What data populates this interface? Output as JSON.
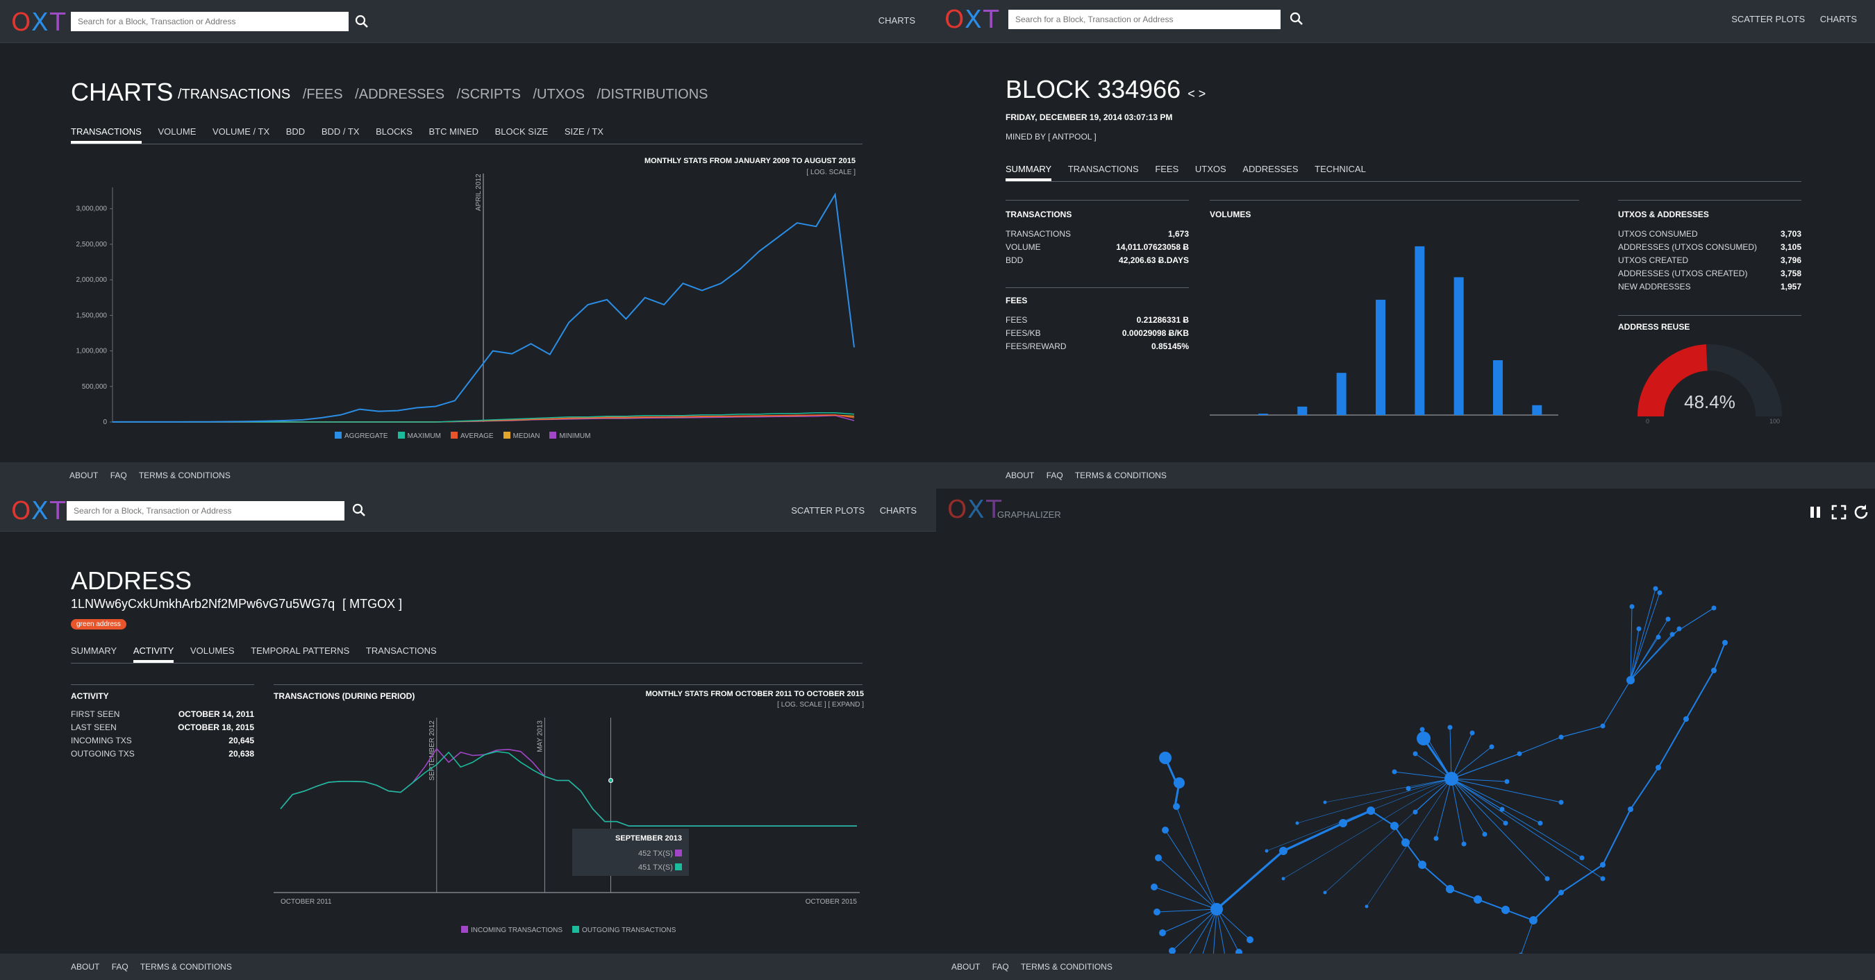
{
  "brand": {
    "logo": "OXT"
  },
  "p1": {
    "search_placeholder": "Search for a Block, Transaction or Address",
    "nav": [
      "CHARTS"
    ],
    "title": "CHARTS",
    "sections": [
      "/TRANSACTIONS",
      "/FEES",
      "/ADDRESSES",
      "/SCRIPTS",
      "/UTXOS",
      "/DISTRIBUTIONS"
    ],
    "tabs": [
      "TRANSACTIONS",
      "VOLUME",
      "VOLUME / TX",
      "BDD",
      "BDD / TX",
      "BLOCKS",
      "BTC MINED",
      "BLOCK SIZE",
      "SIZE / TX"
    ],
    "chart_caption": "MONTHLY STATS FROM JANUARY 2009 TO AUGUST 2015",
    "chart_subcaption": "[ LOG. SCALE ]",
    "marker_label": "APRIL 2012",
    "footer": [
      "ABOUT",
      "FAQ",
      "TERMS & CONDITIONS"
    ]
  },
  "p2": {
    "search_placeholder": "Search for a Block, Transaction or Address",
    "nav": [
      "SCATTER PLOTS",
      "CHARTS"
    ],
    "title": "BLOCK 334966",
    "title_arrows": "< >",
    "date": "FRIDAY, DECEMBER 19, 2014 03:07:13 PM",
    "mined_by": "MINED BY [ ANTPOOL ]",
    "tabs": [
      "SUMMARY",
      "TRANSACTIONS",
      "FEES",
      "UTXOS",
      "ADDRESSES",
      "TECHNICAL"
    ],
    "tx_heading": "TRANSACTIONS",
    "tx_rows": [
      {
        "label": "TRANSACTIONS",
        "value": "1,673"
      },
      {
        "label": "VOLUME",
        "value": "14,011.07623058 Ƀ"
      },
      {
        "label": "BDD",
        "value": "42,206.63 Ƀ.DAYS"
      }
    ],
    "fees_heading": "FEES",
    "fees_rows": [
      {
        "label": "FEES",
        "value": "0.21286331 Ƀ"
      },
      {
        "label": "FEES/KB",
        "value": "0.00029098 Ƀ/KB"
      },
      {
        "label": "FEES/REWARD",
        "value": "0.85145%"
      }
    ],
    "volumes_heading": "VOLUMES",
    "utxo_heading": "UTXOS & ADDRESSES",
    "utxo_rows": [
      {
        "label": "UTXOS CONSUMED",
        "value": "3,703"
      },
      {
        "label": "ADDRESSES (UTXOS CONSUMED)",
        "value": "3,105"
      },
      {
        "label": "UTXOS CREATED",
        "value": "3,796"
      },
      {
        "label": "ADDRESSES (UTXOS CREATED)",
        "value": "3,758"
      },
      {
        "label": "NEW ADDRESSES",
        "value": "1,957"
      }
    ],
    "reuse_heading": "ADDRESS REUSE",
    "reuse_value": "48.4%",
    "reuse_fraction": 0.484,
    "gauge_min": "0",
    "gauge_max": "100",
    "footer": [
      "ABOUT",
      "FAQ",
      "TERMS & CONDITIONS"
    ]
  },
  "p3": {
    "search_placeholder": "Search for a Block, Transaction or Address",
    "nav": [
      "SCATTER PLOTS",
      "CHARTS"
    ],
    "title": "ADDRESS",
    "address": "1LNWw6yCxkUmkhArb2Nf2MPw6vG7u5WG7q",
    "address_tag": "[ MTGOX ]",
    "badge": "green address",
    "tabs": [
      "SUMMARY",
      "ACTIVITY",
      "VOLUMES",
      "TEMPORAL PATTERNS",
      "TRANSACTIONS"
    ],
    "activity_heading": "ACTIVITY",
    "activity_rows": [
      {
        "label": "FIRST SEEN",
        "value": "OCTOBER 14, 2011"
      },
      {
        "label": "LAST SEEN",
        "value": "OCTOBER 18, 2015"
      },
      {
        "label": "INCOMING TXS",
        "value": "20,645"
      },
      {
        "label": "OUTGOING TXS",
        "value": "20,638"
      }
    ],
    "chart_heading": "TRANSACTIONS (DURING PERIOD)",
    "chart_caption": "MONTHLY STATS FROM OCTOBER 2011 TO OCTOBER 2015",
    "chart_subcaption": "[ LOG. SCALE ] [ EXPAND ]",
    "markers": [
      "SEPTEMBER 2012",
      "MAY 2013"
    ],
    "x_start": "OCTOBER 2011",
    "x_end": "OCTOBER 2015",
    "tooltip": {
      "title": "SEPTEMBER 2013",
      "in": "452 TX(S)",
      "out": "451 TX(S)"
    },
    "footer": [
      "ABOUT",
      "FAQ",
      "TERMS & CONDITIONS"
    ]
  },
  "p4": {
    "app_name": "GRAPHALIZER",
    "footer": [
      "ABOUT",
      "FAQ",
      "TERMS & CONDITIONS"
    ]
  },
  "colors": {
    "aggregate": "#2b8ee6",
    "maximum": "#1abc9c",
    "average": "#e8552a",
    "median": "#e0a52a",
    "minimum": "#a246c8",
    "incoming": "#a246c8",
    "outgoing": "#1abc9c"
  },
  "chart_data": [
    {
      "type": "line",
      "title": "MONTHLY STATS FROM JANUARY 2009 TO AUGUST 2015",
      "xlabel": "",
      "ylabel": "",
      "y_ticks": [
        "3,000,000",
        "2,500,000",
        "2,000,000",
        "1,500,000",
        "1,000,000",
        "500,000",
        "0"
      ],
      "ylim": [
        0,
        3300000
      ],
      "x": [
        1,
        3,
        5,
        7,
        9,
        11,
        13,
        15,
        17,
        19,
        21,
        23,
        25,
        27,
        29,
        31,
        33,
        35,
        37,
        39,
        41,
        43,
        45,
        47,
        49,
        51,
        53,
        55,
        57,
        59,
        61,
        63,
        65,
        67,
        69,
        71,
        73,
        75,
        77,
        79
      ],
      "series": [
        {
          "name": "AGGREGATE",
          "values": [
            500,
            600,
            800,
            1000,
            2000,
            3000,
            5000,
            8000,
            12000,
            20000,
            30000,
            60000,
            100000,
            180000,
            150000,
            160000,
            200000,
            220000,
            300000,
            650000,
            1000000,
            960000,
            1100000,
            950000,
            1400000,
            1650000,
            1720000,
            1450000,
            1750000,
            1650000,
            1950000,
            1850000,
            1950000,
            2150000,
            2400000,
            2600000,
            2800000,
            2750000,
            3200000,
            1050000
          ]
        },
        {
          "name": "MAXIMUM",
          "values": [
            0,
            0,
            0,
            0,
            0,
            0,
            0,
            0,
            0,
            0,
            0,
            0,
            0,
            0,
            0,
            0,
            0,
            0,
            10000,
            20000,
            30000,
            40000,
            50000,
            60000,
            70000,
            70000,
            80000,
            80000,
            90000,
            90000,
            90000,
            100000,
            100000,
            110000,
            110000,
            120000,
            120000,
            130000,
            130000,
            110000
          ]
        },
        {
          "name": "AVERAGE",
          "values": [
            0,
            0,
            0,
            0,
            0,
            0,
            0,
            0,
            0,
            0,
            0,
            0,
            0,
            0,
            0,
            0,
            0,
            0,
            8000,
            15000,
            25000,
            30000,
            40000,
            45000,
            55000,
            60000,
            65000,
            65000,
            70000,
            72000,
            75000,
            80000,
            82000,
            85000,
            88000,
            92000,
            95000,
            98000,
            100000,
            60000
          ]
        },
        {
          "name": "MEDIAN",
          "values": [
            0,
            0,
            0,
            0,
            0,
            0,
            0,
            0,
            0,
            0,
            0,
            0,
            0,
            0,
            0,
            0,
            0,
            0,
            6000,
            12000,
            20000,
            25000,
            35000,
            40000,
            50000,
            55000,
            60000,
            60000,
            65000,
            68000,
            70000,
            75000,
            78000,
            80000,
            84000,
            88000,
            90000,
            95000,
            98000,
            80000
          ]
        },
        {
          "name": "MINIMUM",
          "values": [
            0,
            0,
            0,
            0,
            0,
            0,
            0,
            0,
            0,
            0,
            0,
            0,
            0,
            0,
            0,
            0,
            0,
            0,
            4000,
            8000,
            15000,
            20000,
            30000,
            35000,
            40000,
            45000,
            50000,
            50000,
            55000,
            58000,
            60000,
            62000,
            65000,
            70000,
            72000,
            75000,
            78000,
            80000,
            90000,
            20000
          ]
        }
      ],
      "legend": "bottom",
      "grid": false
    },
    {
      "type": "bar",
      "title": "VOLUMES",
      "categories": [
        "1",
        "2",
        "3",
        "4",
        "5",
        "6",
        "7",
        "8"
      ],
      "values": [
        1,
        6,
        30,
        82,
        120,
        98,
        39,
        7
      ],
      "grid": false
    },
    {
      "type": "line",
      "title": "MONTHLY STATS FROM OCTOBER 2011 TO OCTOBER 2015",
      "x": [
        0,
        1,
        2,
        3,
        4,
        5,
        6,
        7,
        8,
        9,
        10,
        11,
        12,
        13,
        14,
        15,
        16,
        17,
        18,
        19,
        20,
        21,
        22,
        23,
        24,
        25,
        26,
        27,
        28,
        29,
        30,
        31,
        32,
        33,
        34,
        35,
        36,
        37,
        38,
        39,
        40,
        41,
        42,
        43,
        44,
        45,
        46,
        47,
        48
      ],
      "series": [
        {
          "name": "INCOMING TRANSACTIONS",
          "values": [
            20,
            35,
            40,
            48,
            56,
            58,
            58,
            57,
            50,
            40,
            38,
            55,
            100,
            200,
            120,
            175,
            155,
            160,
            190,
            195,
            180,
            120,
            70,
            60,
            452,
            40,
            20,
            12,
            12,
            10,
            10,
            10,
            10,
            10,
            10,
            10,
            10,
            10,
            10,
            10,
            10,
            10,
            10,
            10,
            10,
            10,
            10,
            10,
            10
          ]
        },
        {
          "name": "OUTGOING TRANSACTIONS",
          "values": [
            20,
            35,
            40,
            48,
            56,
            58,
            58,
            57,
            50,
            40,
            38,
            55,
            80,
            110,
            175,
            100,
            120,
            160,
            180,
            170,
            120,
            90,
            70,
            60,
            451,
            40,
            20,
            12,
            12,
            10,
            10,
            10,
            10,
            10,
            10,
            10,
            10,
            10,
            10,
            10,
            10,
            10,
            10,
            10,
            10,
            10,
            10,
            10,
            10
          ]
        }
      ],
      "legend": "bottom",
      "grid": false
    }
  ]
}
